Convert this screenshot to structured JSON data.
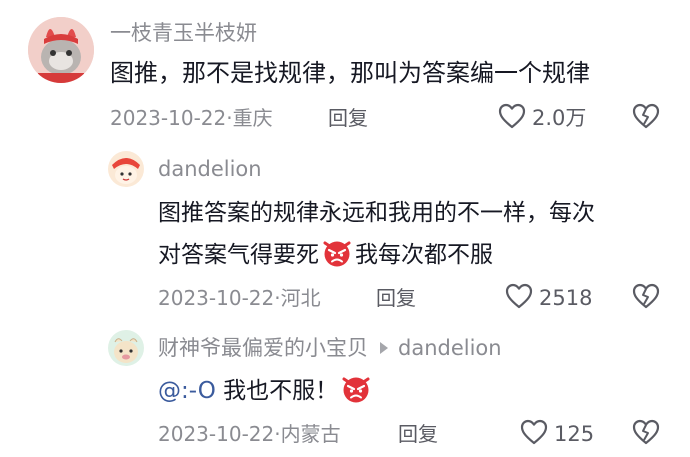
{
  "comments": [
    {
      "username": "一枝青玉半枝妍",
      "text": "图推，那不是找规律，那叫为答案编一个规律",
      "date": "2023-10-22",
      "location": "重庆",
      "reply_label": "回复",
      "likes": "2.0万"
    },
    {
      "username": "dandelion",
      "text_line1": "图推答案的规律永远和我用的不一样，每次",
      "text_line2a": "对答案气得要死",
      "text_line2b": "我每次都不服",
      "date": "2023-10-22",
      "location": "河北",
      "reply_label": "回复",
      "likes": "2518"
    },
    {
      "username": "财神爷最偏爱的小宝贝",
      "reply_to": "dandelion",
      "mention": "@:-O",
      "text": "我也不服！",
      "date": "2023-10-22",
      "location": "内蒙古",
      "reply_label": "回复",
      "likes": "125"
    }
  ],
  "meta_separator": "·",
  "colors": {
    "text": "#161823",
    "muted": "#8a8b91",
    "angry_emoji": "#e2333a"
  },
  "icons": [
    "heart-outline-icon",
    "dislike-heart-icon",
    "angry-face-emoji",
    "reply-arrow-icon"
  ]
}
